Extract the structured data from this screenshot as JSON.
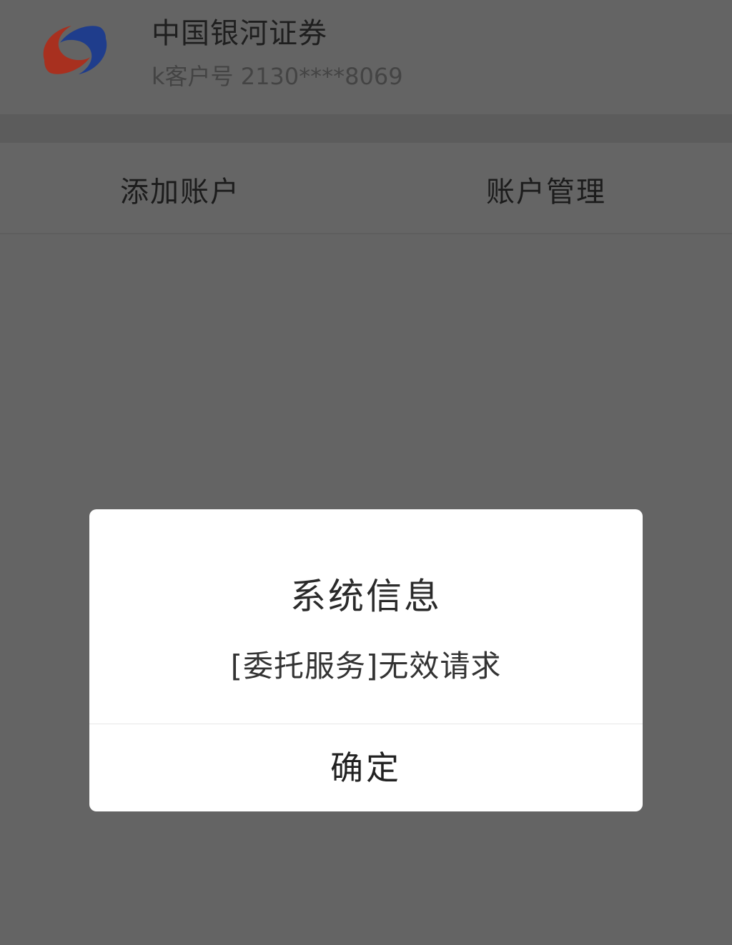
{
  "header": {
    "broker_name": "中国银河证券",
    "account_label": "k客户号 2130****8069",
    "logo_icon": "galaxy-securities-logo",
    "logo_colors": {
      "red": "#a8301f",
      "blue": "#1f3d8c"
    }
  },
  "actions": {
    "add_account": "添加账户",
    "manage_account": "账户管理"
  },
  "dialog": {
    "title": "系统信息",
    "message": "[委托服务]无效请求",
    "confirm_label": "确定"
  }
}
